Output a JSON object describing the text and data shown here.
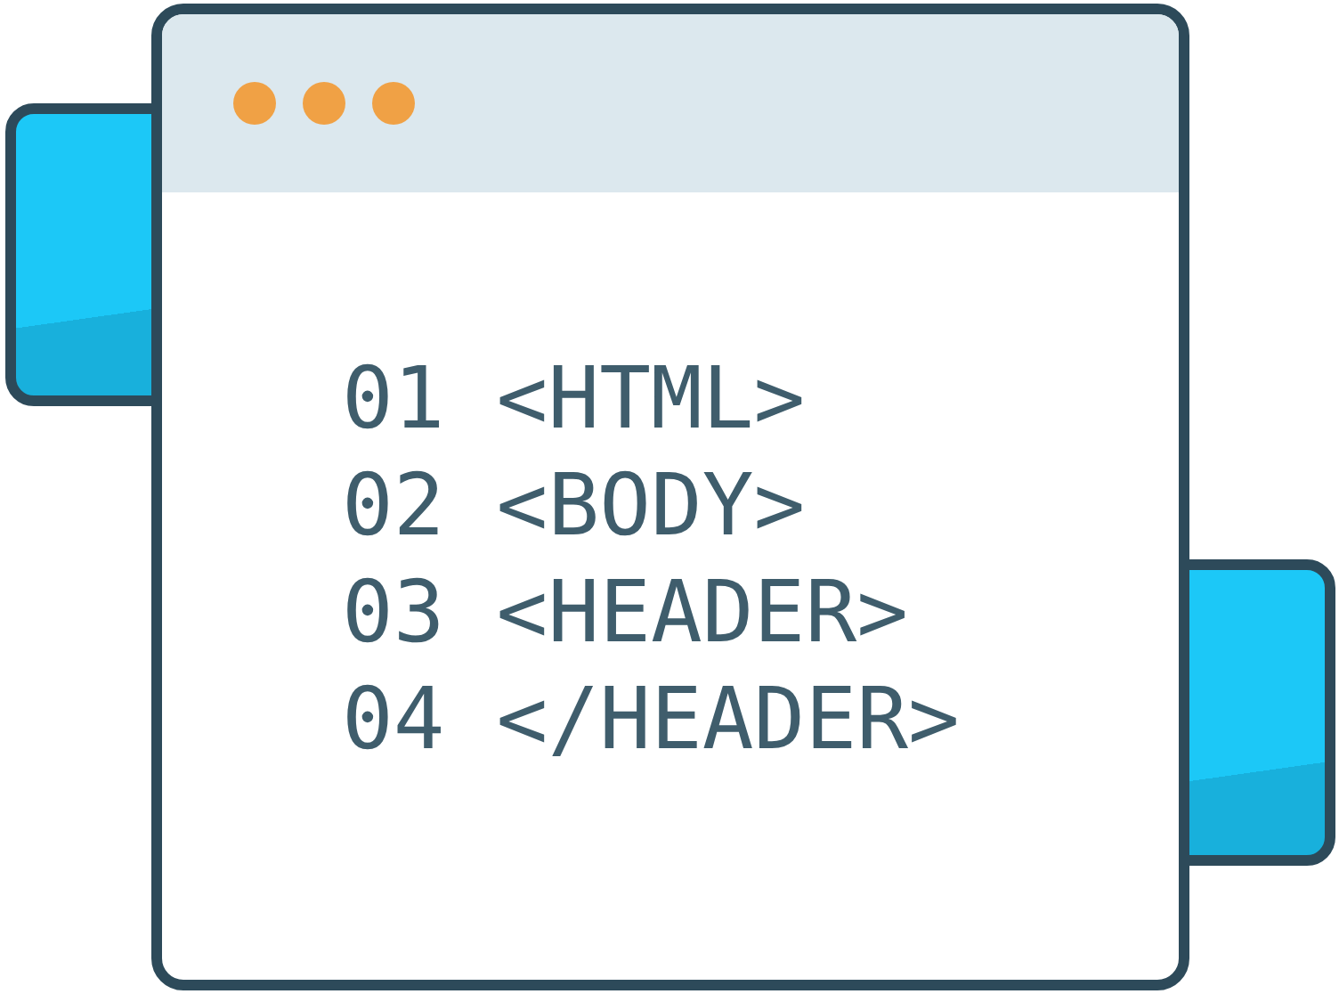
{
  "window": {
    "lines": [
      {
        "number": "01",
        "code": "<HTML>"
      },
      {
        "number": "02",
        "code": "<BODY>"
      },
      {
        "number": "03",
        "code": "<HEADER>"
      },
      {
        "number": "04",
        "code": "</HEADER>"
      }
    ]
  }
}
